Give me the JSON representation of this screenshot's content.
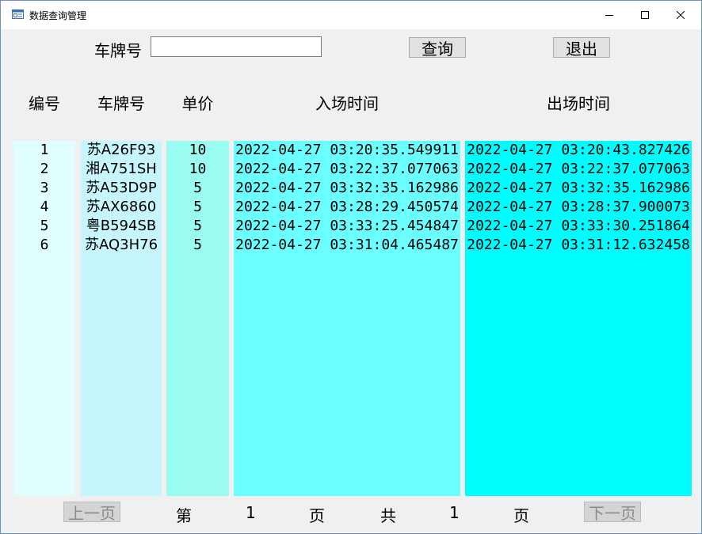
{
  "window": {
    "title": "数据查询管理"
  },
  "search": {
    "label": "车牌号",
    "value": "",
    "query_label": "查询",
    "exit_label": "退出"
  },
  "table": {
    "headers": [
      "编号",
      "车牌号",
      "单价",
      "入场时间",
      "出场时间"
    ],
    "rows": [
      [
        "1",
        "苏A26F93",
        "10",
        "2022-04-27 03:20:35.549911",
        "2022-04-27 03:20:43.827426"
      ],
      [
        "2",
        "湘A751SH",
        "10",
        "2022-04-27 03:22:37.077063",
        "2022-04-27 03:22:37.077063"
      ],
      [
        "3",
        "苏A53D9P",
        "5",
        "2022-04-27 03:32:35.162986",
        "2022-04-27 03:32:35.162986"
      ],
      [
        "4",
        "苏AX6860",
        "5",
        "2022-04-27 03:28:29.450574",
        "2022-04-27 03:28:37.900073"
      ],
      [
        "5",
        "粤B594SB",
        "5",
        "2022-04-27 03:33:25.454847",
        "2022-04-27 03:33:30.251864"
      ],
      [
        "6",
        "苏AQ3H76",
        "5",
        "2022-04-27 03:31:04.465487",
        "2022-04-27 03:31:12.632458"
      ]
    ],
    "column_colors": [
      "#e0fefe",
      "#c6f5fd",
      "#9afcf0",
      "#6bfefe",
      "#00fdfd"
    ]
  },
  "pager": {
    "prev_label": "上一页",
    "page_prefix": "第",
    "current_page": "1",
    "page_suffix": "页",
    "total_prefix": "共",
    "total_pages": "1",
    "total_suffix": "页",
    "next_label": "下一页"
  },
  "icons": {
    "app": "window-app-icon",
    "minimize": "minimize-icon",
    "maximize": "maximize-icon",
    "close": "close-icon"
  }
}
